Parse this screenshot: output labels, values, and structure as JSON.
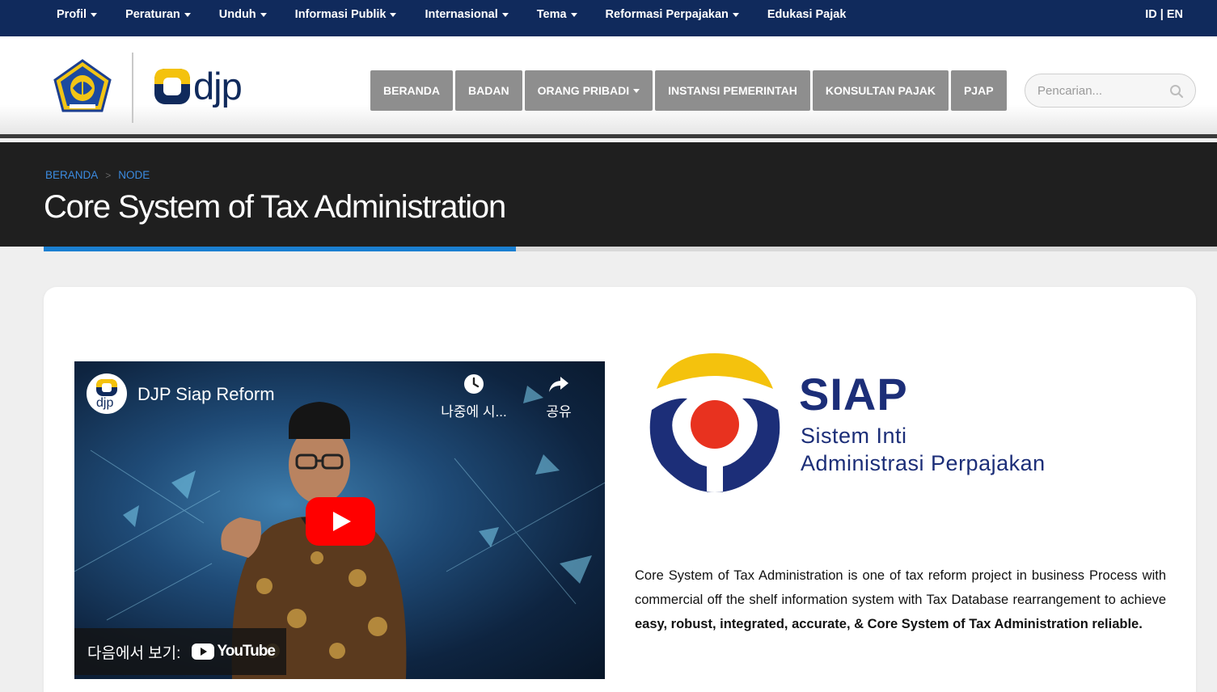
{
  "topnav": {
    "items": [
      {
        "label": "Profil",
        "dropdown": true
      },
      {
        "label": "Peraturan",
        "dropdown": true
      },
      {
        "label": "Unduh",
        "dropdown": true
      },
      {
        "label": "Informasi Publik",
        "dropdown": true
      },
      {
        "label": "Internasional",
        "dropdown": true
      },
      {
        "label": "Tema",
        "dropdown": true
      },
      {
        "label": "Reformasi Perpajakan",
        "dropdown": true
      },
      {
        "label": "Edukasi Pajak",
        "dropdown": false
      }
    ],
    "lang_id": "ID",
    "lang_sep": "|",
    "lang_en": "EN",
    "bg_color": "#102a5c"
  },
  "header": {
    "logo_text": "djp",
    "nav": [
      {
        "label": "BERANDA",
        "dropdown": false
      },
      {
        "label": "BADAN",
        "dropdown": false
      },
      {
        "label": "ORANG PRIBADI",
        "dropdown": true
      },
      {
        "label": "INSTANSI PEMERINTAH",
        "dropdown": false
      },
      {
        "label": "KONSULTAN PAJAK",
        "dropdown": false
      },
      {
        "label": "PJAP",
        "dropdown": false
      }
    ],
    "search_placeholder": "Pencarian..."
  },
  "breadcrumb": {
    "home": "BERANDA",
    "separator": ">",
    "current": "NODE"
  },
  "page_title": "Core System of Tax Administration",
  "video": {
    "title": "DJP Siap Reform",
    "channel_logo_text": "djp",
    "watch_later_label": "나중에 시...",
    "share_label": "공유",
    "watch_on_label": "다음에서 보기:",
    "youtube_label": "YouTube"
  },
  "siap": {
    "name": "SIAP",
    "subtitle_line1": "Sistem Inti",
    "subtitle_line2": "Administrasi Perpajakan",
    "color_navy": "#1c2e78",
    "color_yellow": "#f4c20d",
    "color_red": "#e8321f"
  },
  "description": {
    "plain": "Core System of Tax Administration is one of tax reform project in business Process with commercial off the shelf information system with Tax Database rearrangement to achieve ",
    "bold": "easy, robust, integrated, accurate, & Core System of Tax Administration reliable."
  },
  "colors": {
    "accent_blue": "#1a7fd1",
    "nav_button_grey": "#8e8e8e",
    "title_band": "#1f1f1f"
  }
}
